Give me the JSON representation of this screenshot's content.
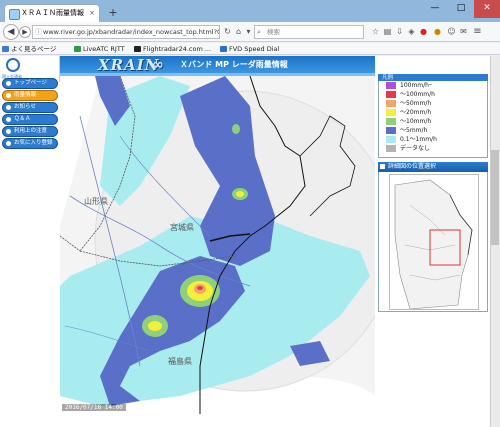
{
  "browser": {
    "tab_title": "ＸＲＡＩＮ雨量情報",
    "url": "www.river.go.jp/xbandradar/index_nowcast_top.html?Ci",
    "search_placeholder": "検索",
    "bookmarks": [
      {
        "label": "よく見るページ",
        "color": "#3a7bd5"
      },
      {
        "label": "LiveATC RJTT",
        "color": "#2c9a3d"
      },
      {
        "label": "Flightradar24.com ...",
        "color": "#222222"
      },
      {
        "label": "FVD Speed Dial",
        "color": "#2a6fd0"
      }
    ]
  },
  "header": {
    "logo_caption": "国土交通省",
    "brand": "XRAIN",
    "title": "Ｘバンド MP レーダ雨量情報"
  },
  "sidebar": {
    "items": [
      {
        "label": "トップページ",
        "active": false
      },
      {
        "label": "雨量情報",
        "active": true
      },
      {
        "label": "お知らせ",
        "active": false
      },
      {
        "label": "Ｑ＆Ａ",
        "active": false
      },
      {
        "label": "利用上の注意",
        "active": false
      },
      {
        "label": "お気に入り登録",
        "active": false
      }
    ]
  },
  "map": {
    "prefectures": [
      "山形県",
      "宮城県",
      "福島県"
    ],
    "timestamp": "2016/07/18 14:00"
  },
  "legend": {
    "header": "凡例",
    "items": [
      {
        "label": "100mm/hｰ",
        "color": "#b14fd8"
      },
      {
        "label": "～100mm/h",
        "color": "#e23a4a"
      },
      {
        "label": "～50mm/h",
        "color": "#f2a46a"
      },
      {
        "label": "～20mm/h",
        "color": "#f3ef3b"
      },
      {
        "label": "～10mm/h",
        "color": "#8fd17b"
      },
      {
        "label": "～5mm/h",
        "color": "#5a6fc7"
      },
      {
        "label": "0.1～1mm/h",
        "color": "#a8ecf0"
      },
      {
        "label": "データなし",
        "color": "#b3b3b3"
      }
    ]
  },
  "mini_panel": {
    "title": "詳細図の位置選択"
  }
}
